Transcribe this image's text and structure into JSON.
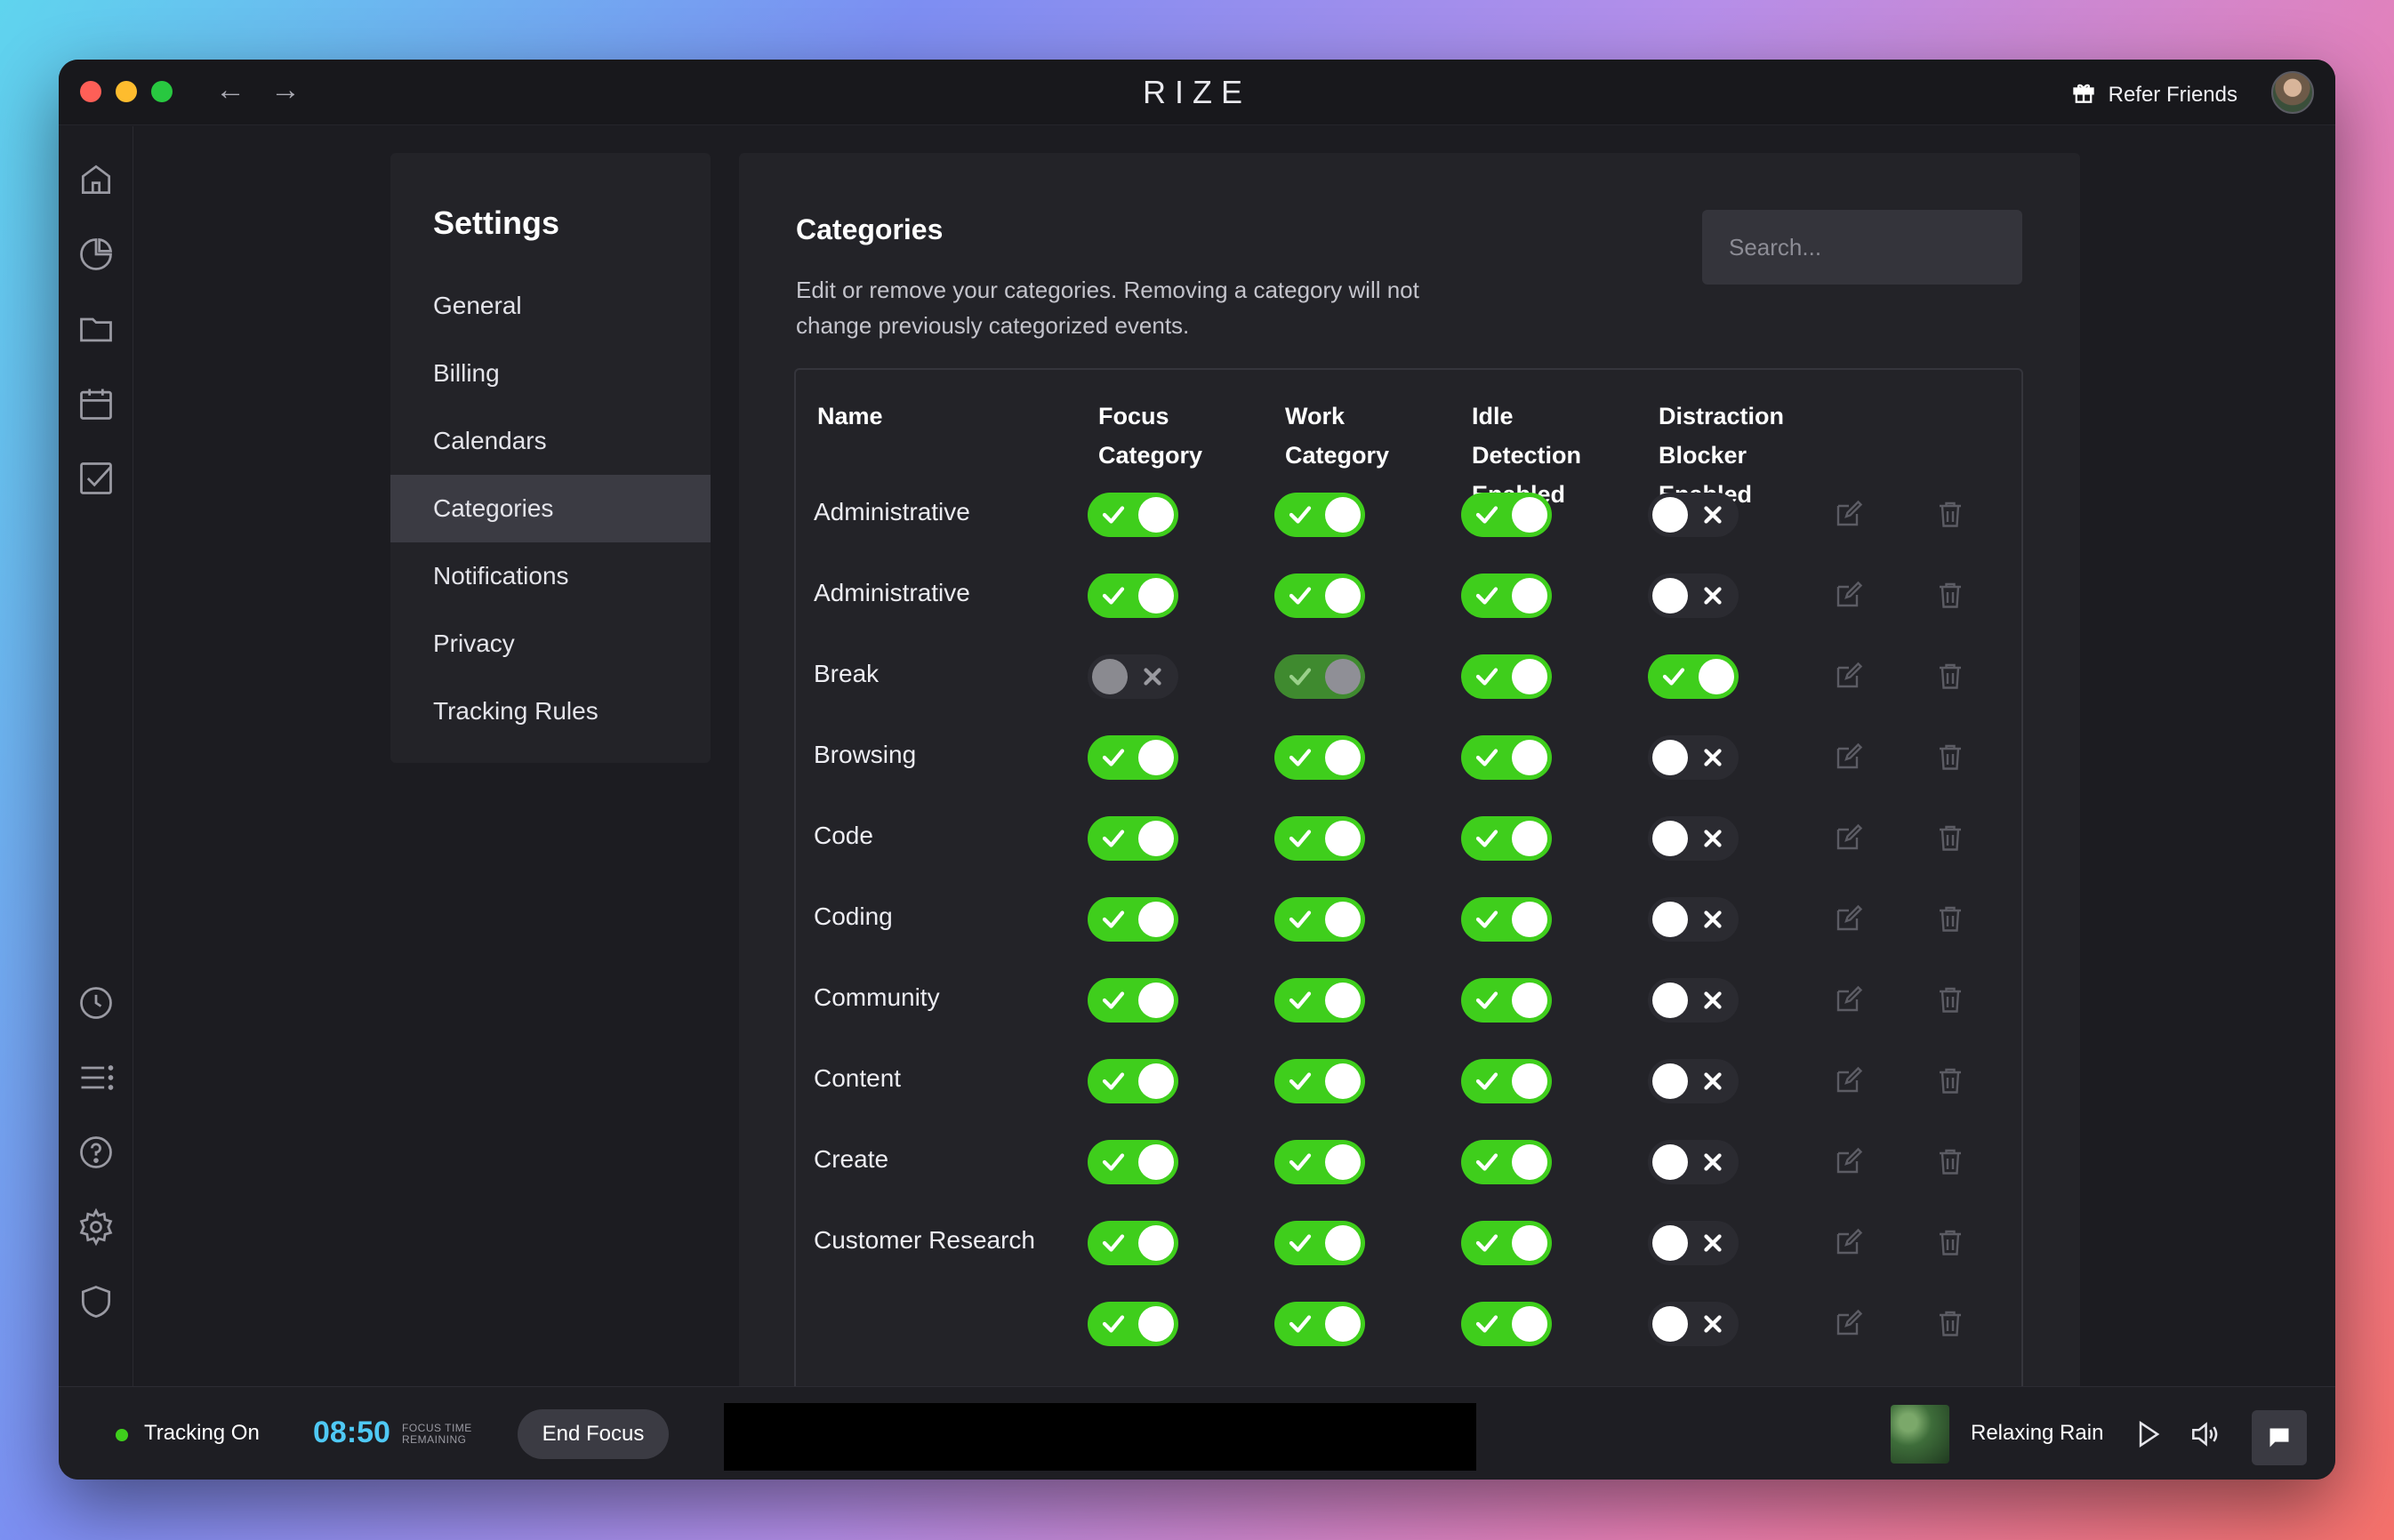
{
  "app": {
    "title": "RIZE",
    "back_arrow": "←",
    "forward_arrow": "→",
    "refer_label": "Refer Friends"
  },
  "sidebar_icons": [
    "home-icon",
    "pie-chart-icon",
    "folder-icon",
    "calendar-icon",
    "checkbox-icon",
    "clock-icon",
    "list-icon",
    "help-icon",
    "gear-icon",
    "shield-icon"
  ],
  "settings": {
    "title": "Settings",
    "items": [
      {
        "label": "General",
        "active": false
      },
      {
        "label": "Billing",
        "active": false
      },
      {
        "label": "Calendars",
        "active": false
      },
      {
        "label": "Categories",
        "active": true
      },
      {
        "label": "Notifications",
        "active": false
      },
      {
        "label": "Privacy",
        "active": false
      },
      {
        "label": "Tracking Rules",
        "active": false
      }
    ]
  },
  "categories": {
    "title": "Categories",
    "description": "Edit or remove your categories. Removing a category will not change previously categorized events.",
    "search_placeholder": "Search...",
    "columns": {
      "name": "Name",
      "focus": [
        "Focus",
        "Category"
      ],
      "work": [
        "Work",
        "Category"
      ],
      "idle": [
        "Idle",
        "Detection",
        "Enabled"
      ],
      "distraction": [
        "Distraction",
        "Blocker",
        "Enabled"
      ]
    },
    "rows": [
      {
        "name": "Administrative",
        "focus": "on",
        "work": "on",
        "idle": "on",
        "distraction": "off"
      },
      {
        "name": "Administrative",
        "focus": "on",
        "work": "on",
        "idle": "on",
        "distraction": "off"
      },
      {
        "name": "Break",
        "focus": "disabled-off",
        "work": "muted",
        "idle": "on",
        "distraction": "on"
      },
      {
        "name": "Browsing",
        "focus": "on",
        "work": "on",
        "idle": "on",
        "distraction": "off"
      },
      {
        "name": "Code",
        "focus": "on",
        "work": "on",
        "idle": "on",
        "distraction": "off"
      },
      {
        "name": "Coding",
        "focus": "on",
        "work": "on",
        "idle": "on",
        "distraction": "off"
      },
      {
        "name": "Community",
        "focus": "on",
        "work": "on",
        "idle": "on",
        "distraction": "off"
      },
      {
        "name": "Content",
        "focus": "on",
        "work": "on",
        "idle": "on",
        "distraction": "off"
      },
      {
        "name": "Create",
        "focus": "on",
        "work": "on",
        "idle": "on",
        "distraction": "off"
      },
      {
        "name": "Customer Research",
        "focus": "on",
        "work": "on",
        "idle": "on",
        "distraction": "off"
      },
      {
        "name": "",
        "focus": "on",
        "work": "on",
        "idle": "on",
        "distraction": "off"
      }
    ]
  },
  "statusbar": {
    "tracking_label": "Tracking On",
    "timer": "08:50",
    "timer_caption_1": "FOCUS TIME",
    "timer_caption_2": "REMAINING",
    "end_focus_label": "End Focus",
    "sound_label": "Relaxing Rain"
  },
  "colors": {
    "accent_green": "#3fce1c",
    "timer_blue": "#4fc9f5",
    "window_bg": "#1c1c21",
    "panel_bg": "#232328"
  }
}
